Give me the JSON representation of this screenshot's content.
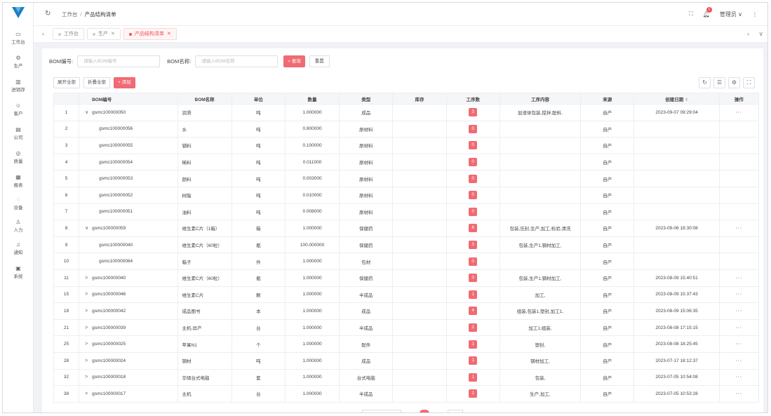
{
  "header": {
    "breadcrumb": [
      "工作台",
      "产品结构清单"
    ],
    "user": "管理员",
    "notification_count": "1"
  },
  "sidebar": {
    "items": [
      {
        "label": "工作台",
        "icon": "monitor-icon"
      },
      {
        "label": "生产",
        "icon": "settings-icon"
      },
      {
        "label": "进销存",
        "icon": "warehouse-icon"
      },
      {
        "label": "客户",
        "icon": "customer-icon"
      },
      {
        "label": "公司",
        "icon": "building-icon"
      },
      {
        "label": "质量",
        "icon": "quality-icon"
      },
      {
        "label": "报表",
        "icon": "report-icon"
      },
      {
        "label": "设备",
        "icon": "device-icon"
      },
      {
        "label": "人力",
        "icon": "user-icon"
      },
      {
        "label": "通知",
        "icon": "bell-icon"
      },
      {
        "label": "系统",
        "icon": "system-icon"
      }
    ]
  },
  "tabs": [
    {
      "label": "工作台",
      "active": false,
      "closable": false
    },
    {
      "label": "生产",
      "active": false,
      "closable": true
    },
    {
      "label": "产品结构清单",
      "active": true,
      "closable": true
    }
  ],
  "search": {
    "bom_code_label": "BOM编号:",
    "bom_code_placeholder": "请输入BOM编号",
    "bom_name_label": "BOM名称:",
    "bom_name_placeholder": "请输入BOM名称",
    "query": "查询",
    "reset": "重置"
  },
  "toolbar": {
    "expand_all": "展开全部",
    "collapse_all": "折叠全部",
    "add": "+ 添加"
  },
  "columns": [
    "",
    "BOM编号",
    "BOM名称",
    "单位",
    "数量",
    "类型",
    "库存",
    "工序数",
    "工序内容",
    "来源",
    "创建日期",
    "操作"
  ],
  "rows": [
    {
      "no": "1",
      "expand": "∨",
      "code": "gsmc100000050",
      "name": "润滑",
      "unit": "吨",
      "qty": "1.000000",
      "type": "成品",
      "stock": "",
      "steps": "3",
      "content": "加液体包装,搅拌,配料,",
      "source": "自产",
      "date": "2023-09-07 09:29:04",
      "ops": "···",
      "child": false
    },
    {
      "no": "2",
      "expand": "",
      "code": "gsmc100000056",
      "name": "水",
      "unit": "吨",
      "qty": "0.800000",
      "type": "原材料",
      "stock": "",
      "steps": "0",
      "content": "",
      "source": "自产",
      "date": "",
      "ops": "",
      "child": true
    },
    {
      "no": "3",
      "expand": "",
      "code": "gsmc100000055",
      "name": "辅料",
      "unit": "吨",
      "qty": "0.100000",
      "type": "原材料",
      "stock": "",
      "steps": "0",
      "content": "",
      "source": "自产",
      "date": "",
      "ops": "",
      "child": true
    },
    {
      "no": "4",
      "expand": "",
      "code": "gsmc100000054",
      "name": "稀料",
      "unit": "吨",
      "qty": "0.011000",
      "type": "原材料",
      "stock": "",
      "steps": "0",
      "content": "",
      "source": "自产",
      "date": "",
      "ops": "",
      "child": true
    },
    {
      "no": "5",
      "expand": "",
      "code": "gsmc100000053",
      "name": "颜料",
      "unit": "吨",
      "qty": "0.003000",
      "type": "原材料",
      "stock": "",
      "steps": "0",
      "content": "",
      "source": "自产",
      "date": "",
      "ops": "",
      "child": true
    },
    {
      "no": "6",
      "expand": "",
      "code": "gsmc100000052",
      "name": "树脂",
      "unit": "吨",
      "qty": "0.010000",
      "type": "原材料",
      "stock": "",
      "steps": "0",
      "content": "",
      "source": "自产",
      "date": "",
      "ops": "",
      "child": true
    },
    {
      "no": "7",
      "expand": "",
      "code": "gsmc100000051",
      "name": "油料",
      "unit": "吨",
      "qty": "0.008000",
      "type": "原材料",
      "stock": "",
      "steps": "0",
      "content": "",
      "source": "自产",
      "date": "",
      "ops": "",
      "child": true
    },
    {
      "no": "8",
      "expand": "∨",
      "code": "gsmc100000059",
      "name": "维生素C片（1箱）",
      "unit": "箱",
      "qty": "1.000000",
      "type": "保健药",
      "stock": "",
      "steps": "6",
      "content": "包装,压封,生产,加工,检验,清洗",
      "source": "自产",
      "date": "2023-09-06 18:30:08",
      "ops": "···",
      "child": false
    },
    {
      "no": "9",
      "expand": "",
      "code": "gsmc100000040",
      "name": "维生素C片（60粒）",
      "unit": "瓶",
      "qty": "100.000000",
      "type": "保健药",
      "stock": "",
      "steps": "3",
      "content": "包装,生产1,钢材加工,",
      "source": "自产",
      "date": "",
      "ops": "",
      "child": true
    },
    {
      "no": "10",
      "expand": "",
      "code": "gsmc100000064",
      "name": "箱子",
      "unit": "件",
      "qty": "1.000000",
      "type": "包材",
      "stock": "",
      "steps": "0",
      "content": "",
      "source": "自产",
      "date": "",
      "ops": "",
      "child": true
    },
    {
      "no": "11",
      "expand": ">",
      "code": "gsmc100000040",
      "name": "维生素C片（60粒）",
      "unit": "瓶",
      "qty": "1.000000",
      "type": "保健药",
      "stock": "",
      "steps": "3",
      "content": "包装,生产1,钢材加工,",
      "source": "自产",
      "date": "2023-08-09 15:40:51",
      "ops": "···",
      "child": false
    },
    {
      "no": "15",
      "expand": ">",
      "code": "gsmc100000046",
      "name": "维生素C片",
      "unit": "颗",
      "qty": "1.000000",
      "type": "半成品",
      "stock": "",
      "steps": "1",
      "content": "加工,",
      "source": "自产",
      "date": "2023-08-09 15:37:43",
      "ops": "···",
      "child": false
    },
    {
      "no": "18",
      "expand": ">",
      "code": "gsmc100000042",
      "name": "成品图书",
      "unit": "本",
      "qty": "1.000000",
      "type": "成品",
      "stock": "",
      "steps": "4",
      "content": "组装,包装1,塑封,加工1,",
      "source": "自产",
      "date": "2023-08-09 15:06:35",
      "ops": "···",
      "child": false
    },
    {
      "no": "21",
      "expand": ">",
      "code": "gsmc100000039",
      "name": "主机-异产",
      "unit": "台",
      "qty": "1.000000",
      "type": "半成品",
      "stock": "",
      "steps": "2",
      "content": "加工1,组装,",
      "source": "自产",
      "date": "2023-08-08 17:15:15",
      "ops": "···",
      "child": false
    },
    {
      "no": "25",
      "expand": ">",
      "code": "gsmc100000025",
      "name": "苹果N1",
      "unit": "个",
      "qty": "1.000000",
      "type": "配件",
      "stock": "",
      "steps": "1",
      "content": "塑封,",
      "source": "自产",
      "date": "2023-08-08 18:25:45",
      "ops": "···",
      "child": false
    },
    {
      "no": "28",
      "expand": ">",
      "code": "gsmc100000024",
      "name": "钢材",
      "unit": "吨",
      "qty": "1.000000",
      "type": "成品",
      "stock": "",
      "steps": "1",
      "content": "钢材加工,",
      "source": "自产",
      "date": "2023-07-17 18:12:37",
      "ops": "···",
      "child": false
    },
    {
      "no": "32",
      "expand": ">",
      "code": "gsmc100000018",
      "name": "华硕台式电脑",
      "unit": "套",
      "qty": "1.000000",
      "type": "台式电脑",
      "stock": "",
      "steps": "1",
      "content": "包装,",
      "source": "自产",
      "date": "2023-07-05 10:54:08",
      "ops": "···",
      "child": false
    },
    {
      "no": "38",
      "expand": ">",
      "code": "gsmc100000017",
      "name": "主机",
      "unit": "台",
      "qty": "1.000000",
      "type": "半成品",
      "stock": "",
      "steps": "2",
      "content": "生产,加工,",
      "source": "自产",
      "date": "2023-07-05 10:53:28",
      "ops": "···",
      "child": false
    }
  ],
  "colors": {
    "accent": "#f0525a",
    "badge": "#f06b73",
    "logo": "#1f7fc0"
  }
}
